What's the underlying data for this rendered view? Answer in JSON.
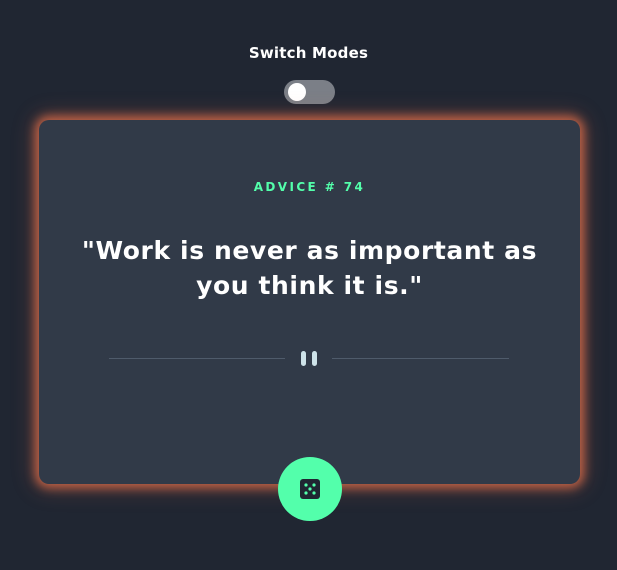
{
  "mode_switch": {
    "label": "Switch Modes",
    "enabled": false
  },
  "card": {
    "advice_id": "ADVICE # 74",
    "advice_text": "\"Work is never as important as you think it is.\""
  },
  "icons": {
    "divider": "pause-icon",
    "generate": "dice-icon"
  },
  "colors": {
    "background": "#202632",
    "card": "#313a48",
    "accent": "#53ffab",
    "glow": "#e8704a",
    "divider": "#4f5b6b"
  }
}
